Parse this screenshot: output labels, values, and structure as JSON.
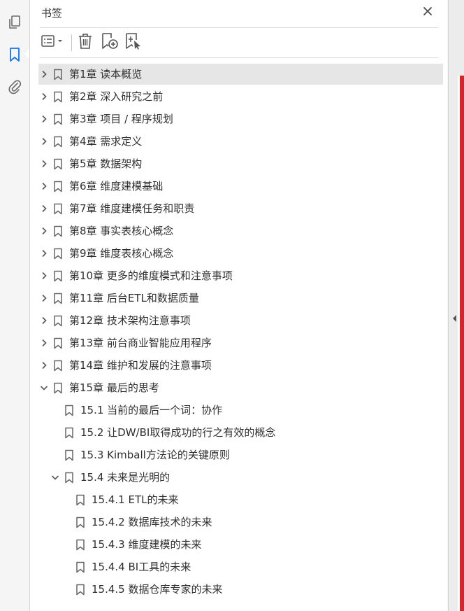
{
  "panel": {
    "title": "书签"
  },
  "toolbar": {
    "icons": [
      "options-list-icon",
      "delete-bookmark-icon",
      "new-bookmark-icon",
      "bookmark-from-selection-icon"
    ]
  },
  "rail": {
    "icons": [
      "pages-icon",
      "bookmarks-icon",
      "attachments-icon"
    ]
  },
  "colors": {
    "accent": "#1473e6",
    "doc_edge": "#d0262e",
    "selected_row": "#e6e6e6"
  },
  "bookmarks": [
    {
      "label": "第1章 读本概览",
      "level": 0,
      "toggle": "collapsed",
      "selected": true
    },
    {
      "label": "第2章 深入研究之前",
      "level": 0,
      "toggle": "collapsed"
    },
    {
      "label": "第3章 项目 / 程序规划",
      "level": 0,
      "toggle": "collapsed"
    },
    {
      "label": "第4章 需求定义",
      "level": 0,
      "toggle": "collapsed"
    },
    {
      "label": "第5章 数据架构",
      "level": 0,
      "toggle": "collapsed"
    },
    {
      "label": "第6章 维度建模基础",
      "level": 0,
      "toggle": "collapsed"
    },
    {
      "label": "第7章 维度建模任务和职责",
      "level": 0,
      "toggle": "collapsed"
    },
    {
      "label": "第8章 事实表核心概念",
      "level": 0,
      "toggle": "collapsed"
    },
    {
      "label": "第9章 维度表核心概念",
      "level": 0,
      "toggle": "collapsed"
    },
    {
      "label": "第10章 更多的维度模式和注意事项",
      "level": 0,
      "toggle": "collapsed"
    },
    {
      "label": "第11章 后台ETL和数据质量",
      "level": 0,
      "toggle": "collapsed"
    },
    {
      "label": "第12章 技术架构注意事项",
      "level": 0,
      "toggle": "collapsed"
    },
    {
      "label": "第13章 前台商业智能应用程序",
      "level": 0,
      "toggle": "collapsed"
    },
    {
      "label": "第14章 维护和发展的注意事项",
      "level": 0,
      "toggle": "collapsed"
    },
    {
      "label": "第15章 最后的思考",
      "level": 0,
      "toggle": "expanded"
    },
    {
      "label": "15.1 当前的最后一个词：协作",
      "level": 1,
      "toggle": "none"
    },
    {
      "label": "15.2 让DW/BI取得成功的行之有效的概念",
      "level": 1,
      "toggle": "none"
    },
    {
      "label": "15.3 Kimball方法论的关键原则",
      "level": 1,
      "toggle": "none"
    },
    {
      "label": "15.4 未来是光明的",
      "level": 1,
      "toggle": "expanded"
    },
    {
      "label": "15.4.1 ETL的未来",
      "level": 2,
      "toggle": "none"
    },
    {
      "label": "15.4.2 数据库技术的未来",
      "level": 2,
      "toggle": "none"
    },
    {
      "label": "15.4.3 维度建模的未来",
      "level": 2,
      "toggle": "none"
    },
    {
      "label": "15.4.4 BI工具的未来",
      "level": 2,
      "toggle": "none"
    },
    {
      "label": "15.4.5 数据仓库专家的未来",
      "level": 2,
      "toggle": "none"
    }
  ]
}
